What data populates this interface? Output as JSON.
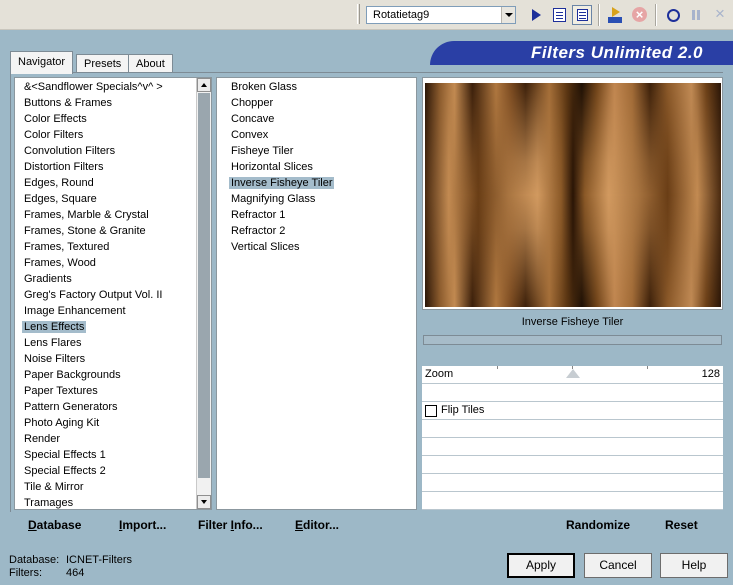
{
  "toolbar": {
    "preset_value": "Rotatietag9",
    "icons": [
      "run-icon",
      "book-icon",
      "grid-view-icon",
      "apply-icon",
      "cancel-icon",
      "record-icon",
      "pause-icon",
      "close-icon"
    ]
  },
  "banner": {
    "title": "Filters Unlimited 2.0"
  },
  "tabs": [
    {
      "label": "Navigator",
      "active": true
    },
    {
      "label": "Presets",
      "active": false
    },
    {
      "label": "About",
      "active": false
    }
  ],
  "categories": [
    "&<Sandflower Specials^v^ >",
    "Buttons & Frames",
    "Color Effects",
    "Color Filters",
    "Convolution Filters",
    "Distortion Filters",
    "Edges, Round",
    "Edges, Square",
    "Frames, Marble & Crystal",
    "Frames, Stone & Granite",
    "Frames, Textured",
    "Frames, Wood",
    "Gradients",
    "Greg's Factory Output Vol. II",
    "Image Enhancement",
    "Lens Effects",
    "Lens Flares",
    "Noise Filters",
    "Paper Backgrounds",
    "Paper Textures",
    "Pattern Generators",
    "Photo Aging Kit",
    "Render",
    "Special Effects 1",
    "Special Effects 2",
    "Tile & Mirror",
    "Tramages"
  ],
  "selected_category": "Lens Effects",
  "filters": [
    "Broken Glass",
    "Chopper",
    "Concave",
    "Convex",
    "Fisheye Tiler",
    "Horizontal Slices",
    "Inverse Fisheye Tiler",
    "Magnifying Glass",
    "Refractor 1",
    "Refractor 2",
    "Vertical Slices"
  ],
  "selected_filter": "Inverse Fisheye Tiler",
  "preview": {
    "filter_name": "Inverse Fisheye Tiler"
  },
  "controls": {
    "zoom": {
      "label": "Zoom",
      "value": "128",
      "fraction": 0.5
    },
    "flip_tiles": {
      "label": "Flip Tiles",
      "checked": false
    }
  },
  "actions": {
    "database": {
      "label": "Database",
      "underline": "D",
      "rest": "atabase"
    },
    "import": {
      "label": "Import...",
      "underline": "I",
      "rest": "mport..."
    },
    "filter_info": {
      "label": "Filter Info...",
      "prefix": "Filter ",
      "underline": "I",
      "rest": "nfo..."
    },
    "editor": {
      "label": "Editor...",
      "underline": "E",
      "rest": "ditor..."
    },
    "randomize": "Randomize",
    "reset": "Reset"
  },
  "status": {
    "database_label": "Database:",
    "database_value": "ICNET-Filters",
    "filters_label": "Filters:",
    "filters_value": "464"
  },
  "buttons": {
    "apply": "Apply",
    "cancel": "Cancel",
    "help": "Help"
  }
}
